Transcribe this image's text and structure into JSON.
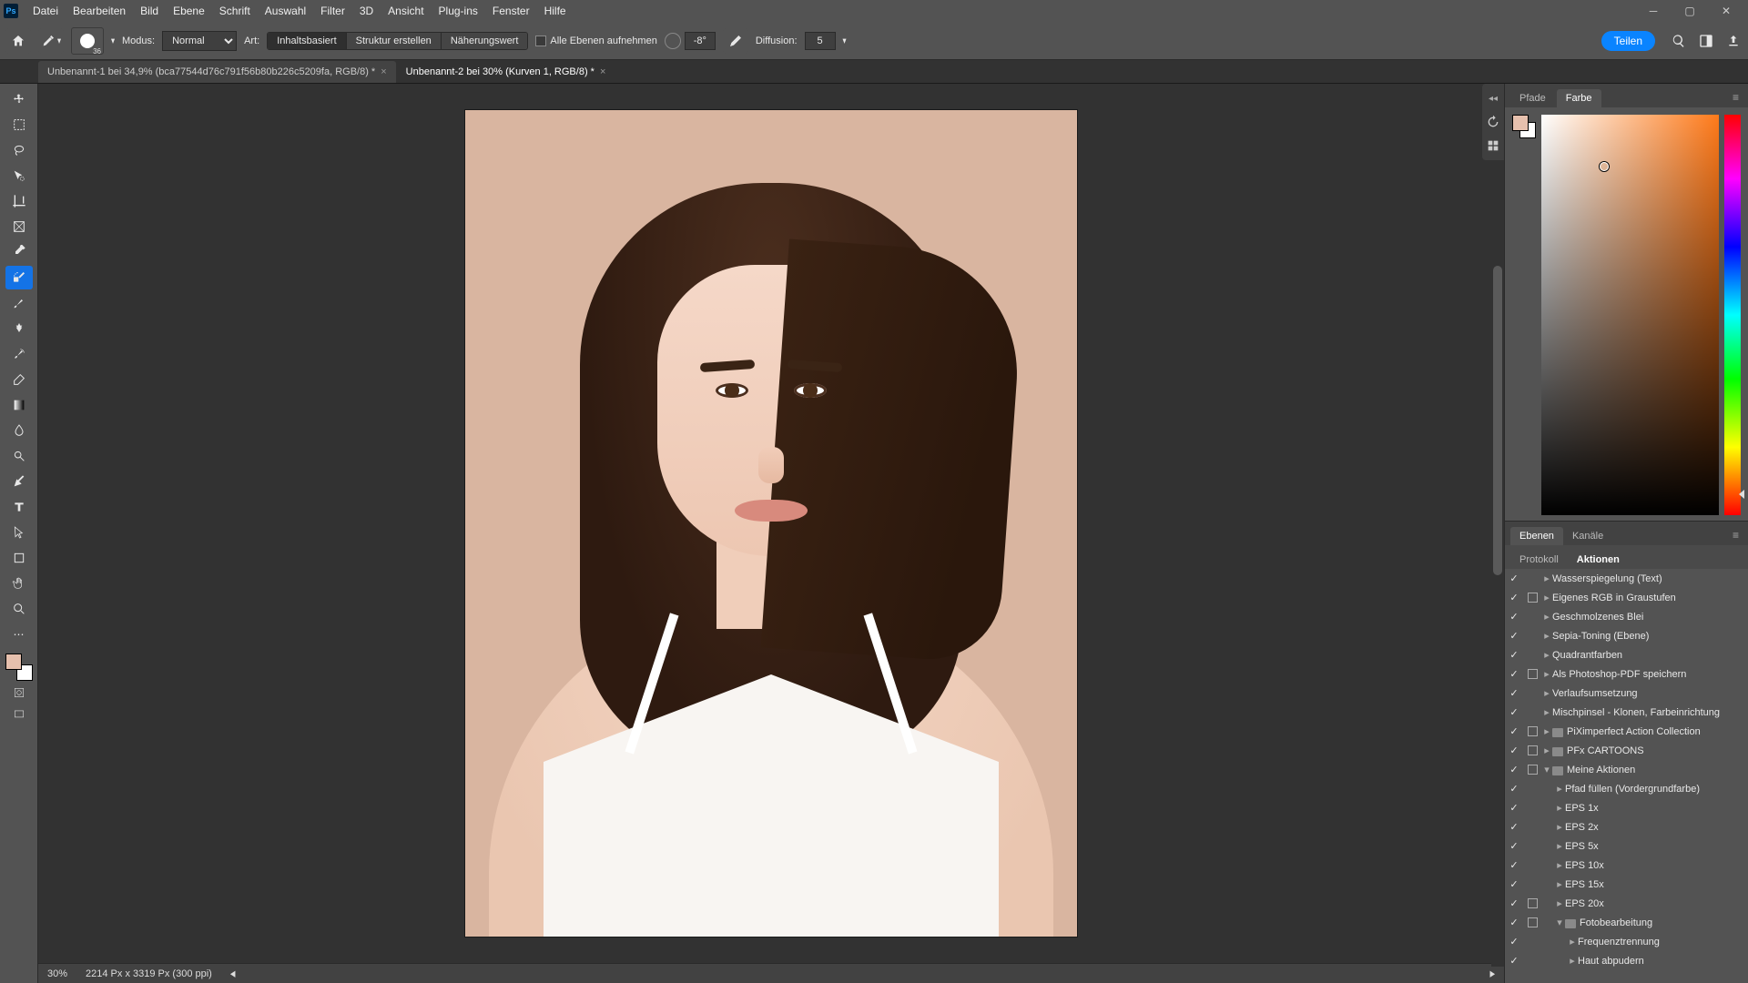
{
  "menubar": {
    "items": [
      "Datei",
      "Bearbeiten",
      "Bild",
      "Ebene",
      "Schrift",
      "Auswahl",
      "Filter",
      "3D",
      "Ansicht",
      "Plug-ins",
      "Fenster",
      "Hilfe"
    ]
  },
  "optionsbar": {
    "brush_size": "36",
    "mode_label": "Modus:",
    "mode_value": "Normal",
    "art_label": "Art:",
    "seg": [
      "Inhaltsbasiert",
      "Struktur erstellen",
      "Näherungswert"
    ],
    "seg_active": 0,
    "sample_all": "Alle Ebenen aufnehmen",
    "angle_value": "-8°",
    "diffusion_label": "Diffusion:",
    "diffusion_value": "5",
    "share": "Teilen"
  },
  "tabs": [
    {
      "label": "Unbenannt-1 bei 34,9% (bca77544d76c791f56b80b226c5209fa, RGB/8) *",
      "active": false
    },
    {
      "label": "Unbenannt-2 bei 30% (Kurven 1, RGB/8) *",
      "active": true
    }
  ],
  "statusbar": {
    "zoom": "30%",
    "dims": "2214 Px x 3319 Px (300 ppi)"
  },
  "color_panel": {
    "tabs": [
      "Pfade",
      "Farbe"
    ],
    "active_tab": 1
  },
  "bottom_panel": {
    "main_tabs": [
      "Ebenen",
      "Kanäle"
    ],
    "main_active": 0,
    "sub_tabs": [
      "Protokoll",
      "Aktionen"
    ],
    "sub_active": 1
  },
  "actions": [
    {
      "vis": true,
      "dlg": false,
      "indent": 0,
      "twisty": ">",
      "folder": false,
      "name": "Wasserspiegelung (Text)"
    },
    {
      "vis": true,
      "dlg": true,
      "indent": 0,
      "twisty": ">",
      "folder": false,
      "name": "Eigenes RGB in Graustufen"
    },
    {
      "vis": true,
      "dlg": false,
      "indent": 0,
      "twisty": ">",
      "folder": false,
      "name": "Geschmolzenes Blei"
    },
    {
      "vis": true,
      "dlg": false,
      "indent": 0,
      "twisty": ">",
      "folder": false,
      "name": "Sepia-Toning (Ebene)"
    },
    {
      "vis": true,
      "dlg": false,
      "indent": 0,
      "twisty": ">",
      "folder": false,
      "name": "Quadrantfarben"
    },
    {
      "vis": true,
      "dlg": true,
      "indent": 0,
      "twisty": ">",
      "folder": false,
      "name": "Als Photoshop-PDF speichern"
    },
    {
      "vis": true,
      "dlg": false,
      "indent": 0,
      "twisty": ">",
      "folder": false,
      "name": "Verlaufsumsetzung"
    },
    {
      "vis": true,
      "dlg": false,
      "indent": 0,
      "twisty": ">",
      "folder": false,
      "name": "Mischpinsel - Klonen, Farbeinrichtung"
    },
    {
      "vis": true,
      "dlg": true,
      "indent": 0,
      "twisty": ">",
      "folder": true,
      "name": "PiXimperfect Action Collection"
    },
    {
      "vis": true,
      "dlg": true,
      "indent": 0,
      "twisty": ">",
      "folder": true,
      "name": "PFx CARTOONS"
    },
    {
      "vis": true,
      "dlg": true,
      "indent": 0,
      "twisty": "v",
      "folder": true,
      "name": "Meine Aktionen"
    },
    {
      "vis": true,
      "dlg": false,
      "indent": 1,
      "twisty": ">",
      "folder": false,
      "name": "Pfad füllen (Vordergrundfarbe)"
    },
    {
      "vis": true,
      "dlg": false,
      "indent": 1,
      "twisty": ">",
      "folder": false,
      "name": "EPS 1x"
    },
    {
      "vis": true,
      "dlg": false,
      "indent": 1,
      "twisty": ">",
      "folder": false,
      "name": "EPS 2x"
    },
    {
      "vis": true,
      "dlg": false,
      "indent": 1,
      "twisty": ">",
      "folder": false,
      "name": "EPS 5x"
    },
    {
      "vis": true,
      "dlg": false,
      "indent": 1,
      "twisty": ">",
      "folder": false,
      "name": "EPS 10x"
    },
    {
      "vis": true,
      "dlg": false,
      "indent": 1,
      "twisty": ">",
      "folder": false,
      "name": "EPS 15x"
    },
    {
      "vis": true,
      "dlg": true,
      "indent": 1,
      "twisty": ">",
      "folder": false,
      "name": "EPS 20x"
    },
    {
      "vis": true,
      "dlg": true,
      "indent": 1,
      "twisty": "v",
      "folder": true,
      "name": "Fotobearbeitung"
    },
    {
      "vis": true,
      "dlg": false,
      "indent": 2,
      "twisty": ">",
      "folder": false,
      "name": "Frequenztrennung"
    },
    {
      "vis": true,
      "dlg": false,
      "indent": 2,
      "twisty": ">",
      "folder": false,
      "name": "Haut abpudern"
    }
  ]
}
